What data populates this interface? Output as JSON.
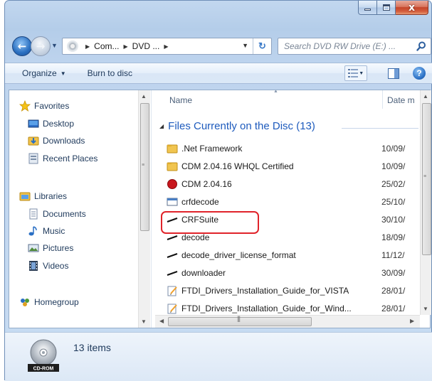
{
  "window": {
    "close_symbol": "x"
  },
  "address": {
    "crumbs": [
      "Com...",
      "DVD ..."
    ]
  },
  "search": {
    "placeholder": "Search DVD RW Drive (E:) ..."
  },
  "toolbar": {
    "organize": "Organize",
    "burn": "Burn to disc"
  },
  "nav": {
    "favorites": "Favorites",
    "desktop": "Desktop",
    "downloads": "Downloads",
    "recent": "Recent Places",
    "libraries": "Libraries",
    "documents": "Documents",
    "music": "Music",
    "pictures": "Pictures",
    "videos": "Videos",
    "homegroup": "Homegroup"
  },
  "columns": {
    "name": "Name",
    "date": "Date m"
  },
  "group": {
    "title": "Files Currently on the Disc (13)"
  },
  "files": [
    {
      "name": ".Net Framework",
      "date": "10/09/",
      "icon": "folder-icon"
    },
    {
      "name": "CDM 2.04.16 WHQL Certified",
      "date": "10/09/",
      "icon": "folder-icon"
    },
    {
      "name": "CDM 2.04.16",
      "date": "25/02/",
      "icon": "app-icon"
    },
    {
      "name": "crfdecode",
      "date": "25/10/",
      "icon": "window-icon"
    },
    {
      "name": "CRFSuite",
      "date": "30/10/",
      "icon": "file-icon"
    },
    {
      "name": "decode",
      "date": "18/09/",
      "icon": "file-icon"
    },
    {
      "name": "decode_driver_license_format",
      "date": "11/12/",
      "icon": "file-icon"
    },
    {
      "name": "downloader",
      "date": "30/09/",
      "icon": "file-icon"
    },
    {
      "name": "FTDI_Drivers_Installation_Guide_for_VISTA",
      "date": "28/01/",
      "icon": "document-icon"
    },
    {
      "name": "FTDI_Drivers_Installation_Guide_for_Wind...",
      "date": "28/01/",
      "icon": "document-icon"
    }
  ],
  "status": {
    "count": "13 items",
    "drive_label": "CD-ROM"
  },
  "colors": {
    "accent": "#1e5bbd",
    "highlight": "#e0232a"
  }
}
